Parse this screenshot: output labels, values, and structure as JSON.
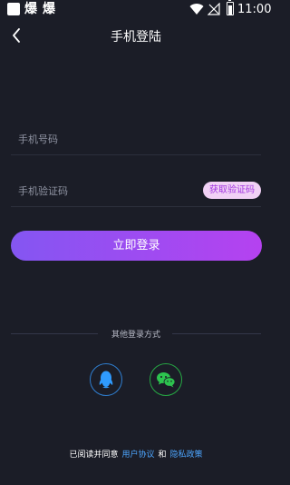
{
  "status_bar": {
    "notif_1": "爆",
    "notif_2": "爆",
    "battery_icon_text": "⚡",
    "time": "11:00"
  },
  "header": {
    "title": "手机登陆"
  },
  "form": {
    "phone_placeholder": "手机号码",
    "code_placeholder": "手机验证码",
    "get_code_label": "获取验证码",
    "login_label": "立即登录"
  },
  "other_login": {
    "title": "其他登录方式",
    "options": [
      "qq",
      "wechat"
    ]
  },
  "agreement": {
    "prefix": "已阅读并同意",
    "user_agreement": "用户协议",
    "and": "和",
    "privacy_policy": "隐私政策"
  },
  "colors": {
    "background": "#1b1d27",
    "gradient_start": "#8456f2",
    "gradient_end": "#b542f0",
    "link": "#4da6ff",
    "qq_blue": "#2f9bff",
    "wechat_green": "#2dc44f"
  }
}
